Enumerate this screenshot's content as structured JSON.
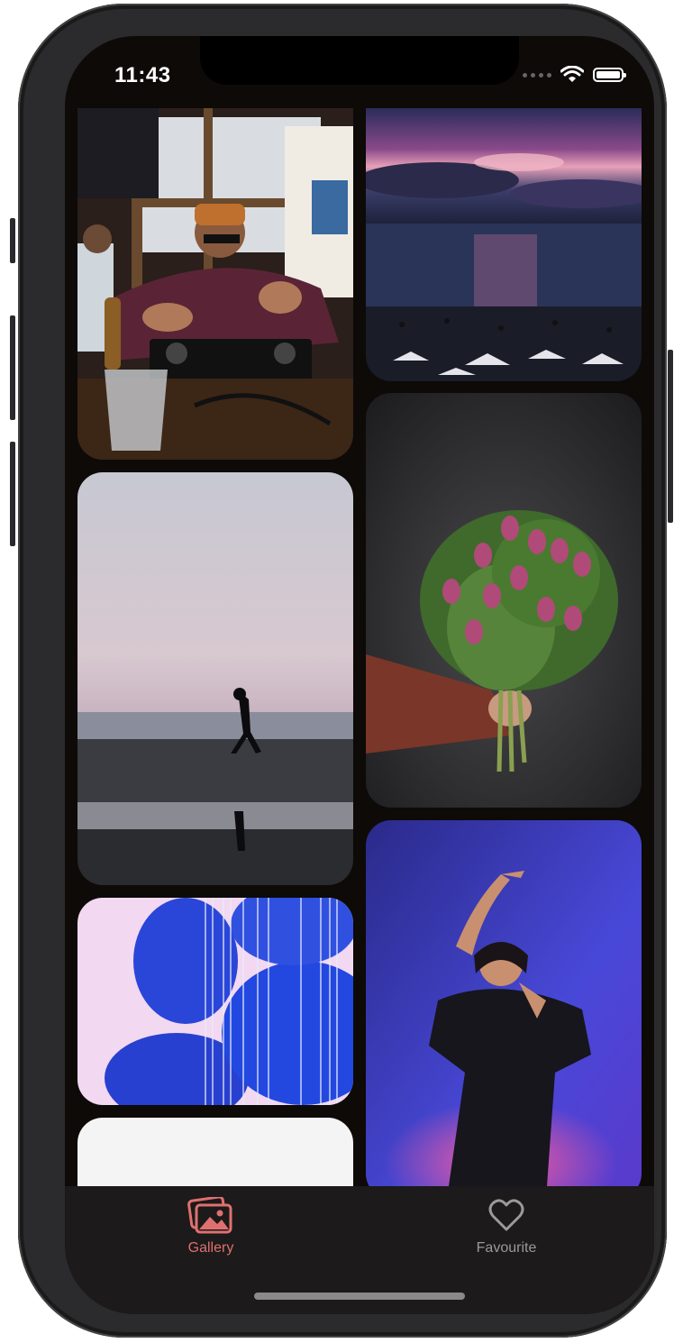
{
  "status_bar": {
    "time": "11:43"
  },
  "gallery": {
    "photos": [
      {
        "id": "dj",
        "description_icon": "photo-dj-party"
      },
      {
        "id": "sunset",
        "description_icon": "photo-beach-sunset"
      },
      {
        "id": "beach",
        "description_icon": "photo-beach-walker"
      },
      {
        "id": "tulips",
        "description_icon": "photo-tulip-bouquet"
      },
      {
        "id": "abstract",
        "description_icon": "photo-blue-abstract"
      },
      {
        "id": "portrait",
        "description_icon": "photo-neon-portrait"
      },
      {
        "id": "blank",
        "description_icon": "photo-loading"
      }
    ]
  },
  "tabbar": {
    "gallery_label": "Gallery",
    "favourite_label": "Favourite",
    "active_color": "#e07070",
    "inactive_color": "#9a9a9a",
    "active_tab": "Gallery"
  }
}
